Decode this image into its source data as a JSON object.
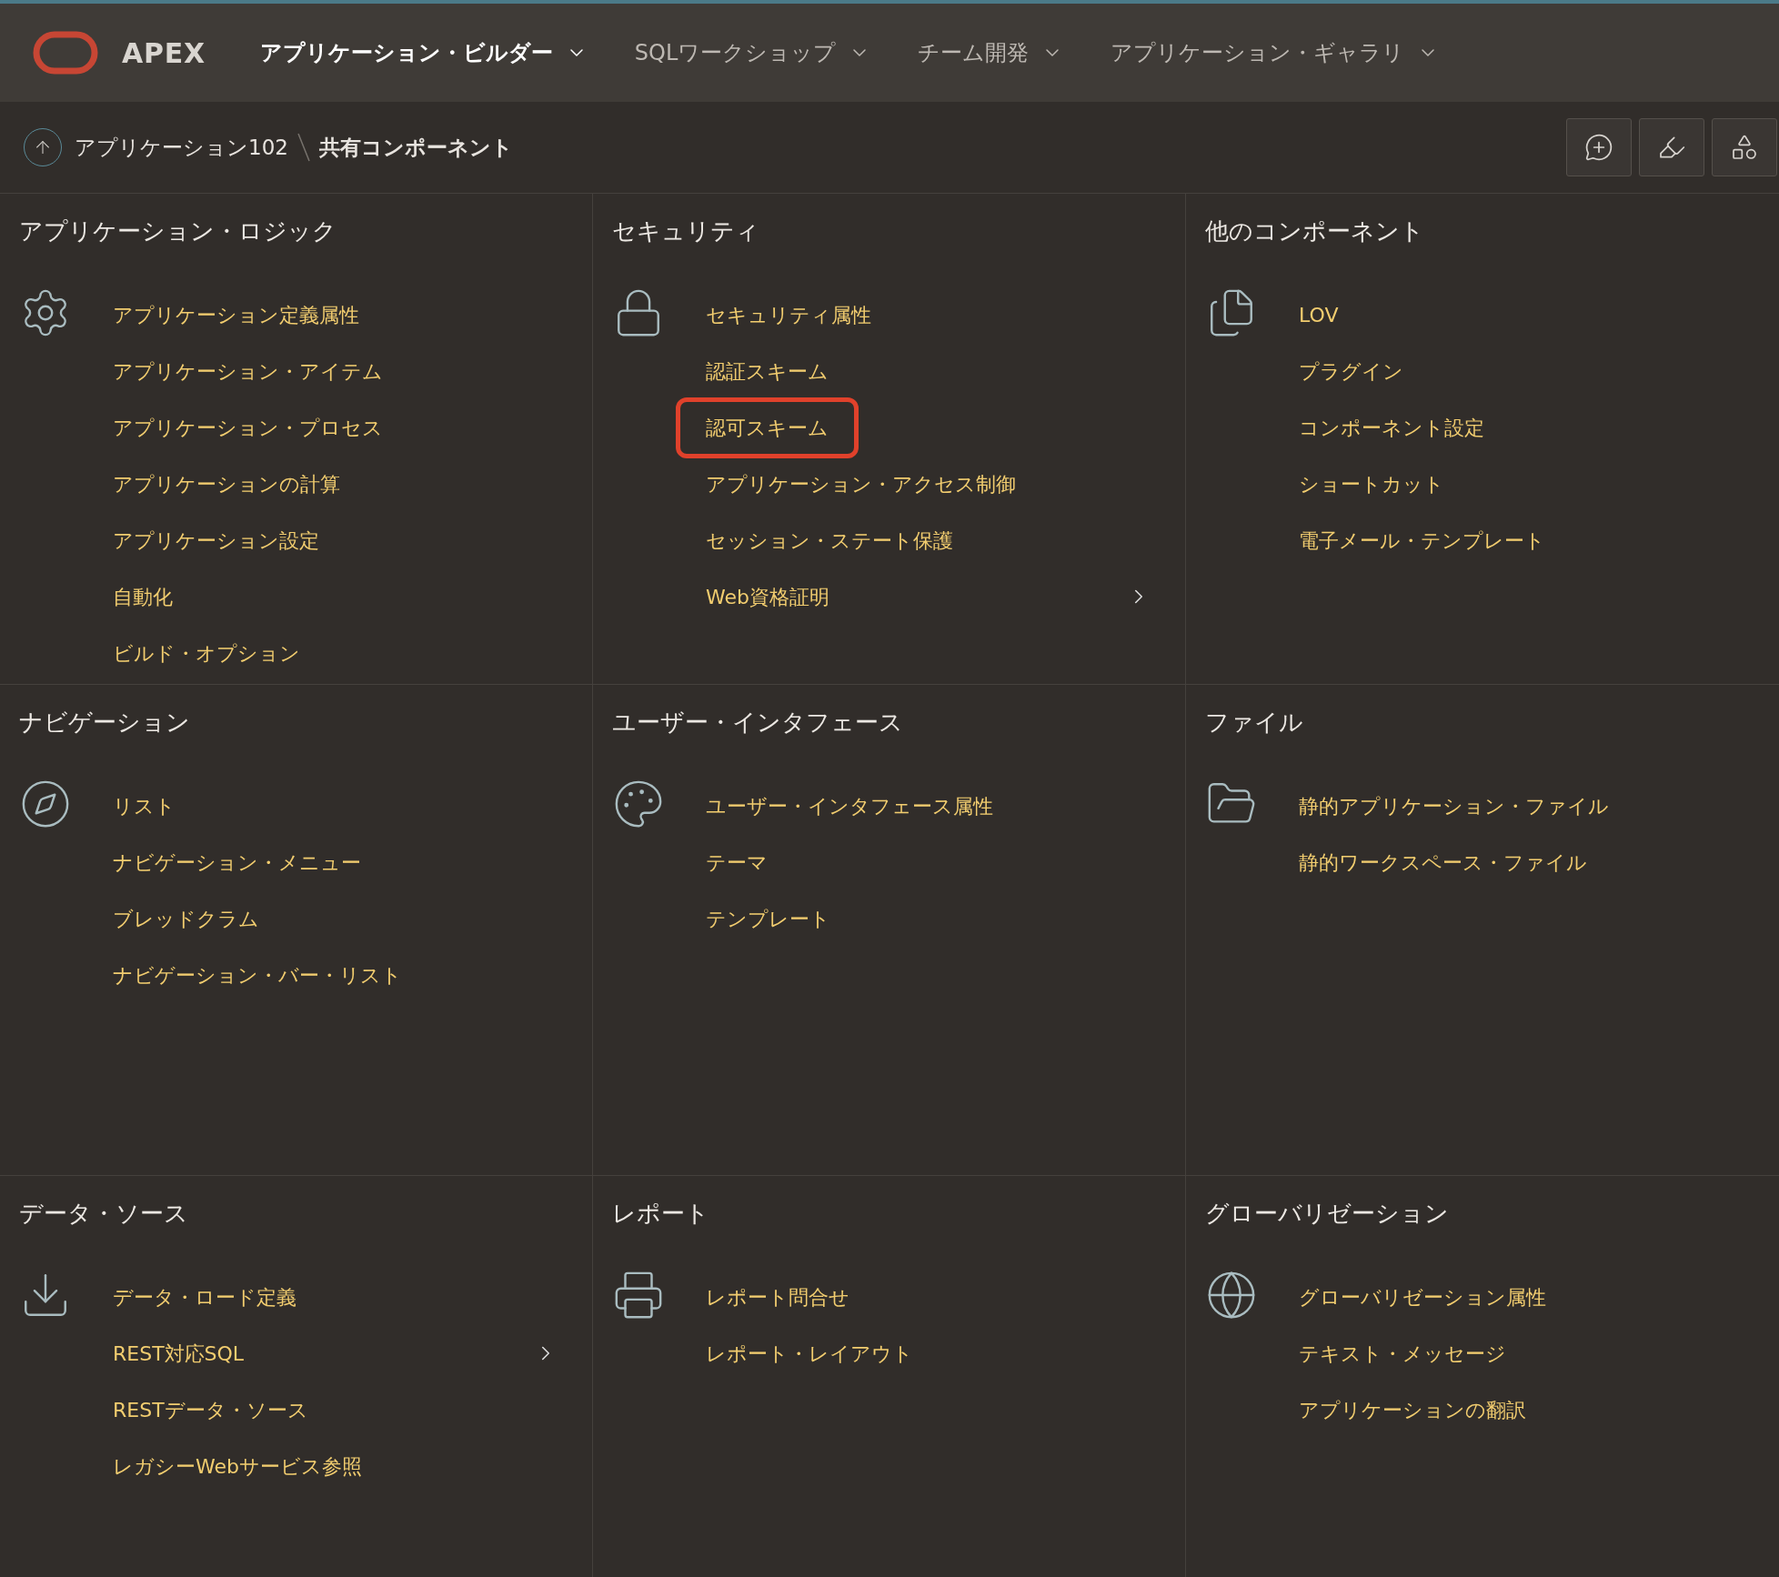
{
  "header": {
    "brand": "APEX",
    "nav": [
      {
        "label": "アプリケーション・ビルダー",
        "selected": true
      },
      {
        "label": "SQLワークショップ",
        "selected": false
      },
      {
        "label": "チーム開発",
        "selected": false
      },
      {
        "label": "アプリケーション・ギャラリ",
        "selected": false
      }
    ]
  },
  "breadcrumb": {
    "parent": "アプリケーション102",
    "current": "共有コンポーネント"
  },
  "sections": [
    {
      "title": "アプリケーション・ロジック",
      "items": [
        {
          "label": "アプリケーション定義属性",
          "highlighted": false,
          "has_submenu": false
        },
        {
          "label": "アプリケーション・アイテム",
          "highlighted": false,
          "has_submenu": false
        },
        {
          "label": "アプリケーション・プロセス",
          "highlighted": false,
          "has_submenu": false
        },
        {
          "label": "アプリケーションの計算",
          "highlighted": false,
          "has_submenu": false
        },
        {
          "label": "アプリケーション設定",
          "highlighted": false,
          "has_submenu": false
        },
        {
          "label": "自動化",
          "highlighted": false,
          "has_submenu": false
        },
        {
          "label": "ビルド・オプション",
          "highlighted": false,
          "has_submenu": false
        }
      ]
    },
    {
      "title": "セキュリティ",
      "items": [
        {
          "label": "セキュリティ属性",
          "highlighted": false,
          "has_submenu": false
        },
        {
          "label": "認証スキーム",
          "highlighted": false,
          "has_submenu": false
        },
        {
          "label": "認可スキーム",
          "highlighted": true,
          "has_submenu": false
        },
        {
          "label": "アプリケーション・アクセス制御",
          "highlighted": false,
          "has_submenu": false
        },
        {
          "label": "セッション・ステート保護",
          "highlighted": false,
          "has_submenu": false
        },
        {
          "label": "Web資格証明",
          "highlighted": false,
          "has_submenu": true
        }
      ]
    },
    {
      "title": "他のコンポーネント",
      "items": [
        {
          "label": "LOV",
          "highlighted": false,
          "has_submenu": false
        },
        {
          "label": "プラグイン",
          "highlighted": false,
          "has_submenu": false
        },
        {
          "label": "コンポーネント設定",
          "highlighted": false,
          "has_submenu": false
        },
        {
          "label": "ショートカット",
          "highlighted": false,
          "has_submenu": false
        },
        {
          "label": "電子メール・テンプレート",
          "highlighted": false,
          "has_submenu": false
        }
      ]
    },
    {
      "title": "ナビゲーション",
      "items": [
        {
          "label": "リスト",
          "highlighted": false,
          "has_submenu": false
        },
        {
          "label": "ナビゲーション・メニュー",
          "highlighted": false,
          "has_submenu": false
        },
        {
          "label": "ブレッドクラム",
          "highlighted": false,
          "has_submenu": false
        },
        {
          "label": "ナビゲーション・バー・リスト",
          "highlighted": false,
          "has_submenu": false
        }
      ]
    },
    {
      "title": "ユーザー・インタフェース",
      "items": [
        {
          "label": "ユーザー・インタフェース属性",
          "highlighted": false,
          "has_submenu": false
        },
        {
          "label": "テーマ",
          "highlighted": false,
          "has_submenu": false
        },
        {
          "label": "テンプレート",
          "highlighted": false,
          "has_submenu": false
        }
      ]
    },
    {
      "title": "ファイル",
      "items": [
        {
          "label": "静的アプリケーション・ファイル",
          "highlighted": false,
          "has_submenu": false
        },
        {
          "label": "静的ワークスペース・ファイル",
          "highlighted": false,
          "has_submenu": false
        }
      ]
    },
    {
      "title": "データ・ソース",
      "items": [
        {
          "label": "データ・ロード定義",
          "highlighted": false,
          "has_submenu": false
        },
        {
          "label": "REST対応SQL",
          "highlighted": false,
          "has_submenu": true
        },
        {
          "label": "RESTデータ・ソース",
          "highlighted": false,
          "has_submenu": false
        },
        {
          "label": "レガシーWebサービス参照",
          "highlighted": false,
          "has_submenu": false
        }
      ]
    },
    {
      "title": "レポート",
      "items": [
        {
          "label": "レポート問合せ",
          "highlighted": false,
          "has_submenu": false
        },
        {
          "label": "レポート・レイアウト",
          "highlighted": false,
          "has_submenu": false
        }
      ]
    },
    {
      "title": "グローバリゼーション",
      "items": [
        {
          "label": "グローバリゼーション属性",
          "highlighted": false,
          "has_submenu": false
        },
        {
          "label": "テキスト・メッセージ",
          "highlighted": false,
          "has_submenu": false
        },
        {
          "label": "アプリケーションの翻訳",
          "highlighted": false,
          "has_submenu": false
        }
      ]
    }
  ]
}
